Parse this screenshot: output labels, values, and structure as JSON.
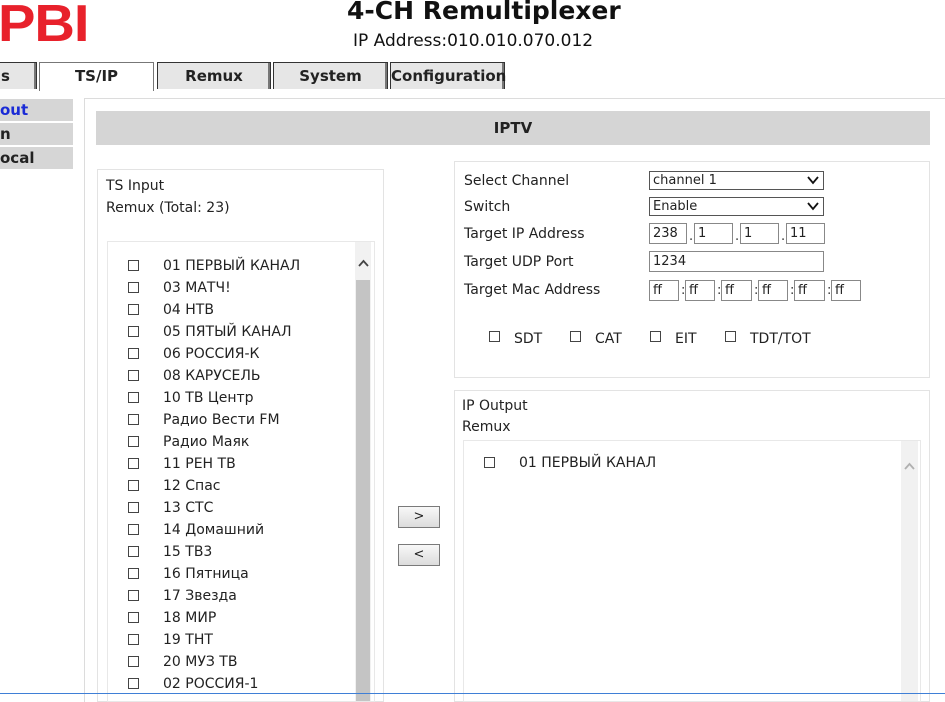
{
  "header": {
    "logo": "PBI",
    "title": "4-CH Remultiplexer",
    "ip_address": "IP Address:010.010.070.012"
  },
  "tabs": [
    {
      "label": "s"
    },
    {
      "label": "TS/IP"
    },
    {
      "label": "Remux"
    },
    {
      "label": "System"
    },
    {
      "label": "Configuration"
    }
  ],
  "sidebar": {
    "items": [
      {
        "label": "out"
      },
      {
        "label": "n"
      },
      {
        "label": "ocal"
      }
    ]
  },
  "section_title": "IPTV",
  "ts_input": {
    "title": "TS Input",
    "subtitle": "Remux (Total: 23)",
    "items": [
      {
        "label": "01 ПЕРВЫЙ КАНАЛ"
      },
      {
        "label": "03 МАТЧ!"
      },
      {
        "label": "04 НТВ"
      },
      {
        "label": "05 ПЯТЫЙ КАНАЛ"
      },
      {
        "label": "06 РОССИЯ-К"
      },
      {
        "label": "08 КАРУСЕЛЬ"
      },
      {
        "label": "10 ТВ Центр"
      },
      {
        "label": "Радио Вести FM"
      },
      {
        "label": "Радио Маяк"
      },
      {
        "label": "11 РЕН ТВ"
      },
      {
        "label": "12 Спас"
      },
      {
        "label": "13 СТС"
      },
      {
        "label": "14 Домашний"
      },
      {
        "label": "15 ТВ3"
      },
      {
        "label": "16 Пятница"
      },
      {
        "label": "17 Звезда"
      },
      {
        "label": "18 МИР"
      },
      {
        "label": "19 ТНТ"
      },
      {
        "label": "20 МУЗ ТВ"
      },
      {
        "label": "02 РОССИЯ-1"
      }
    ]
  },
  "settings": {
    "select_channel_label": "Select Channel",
    "select_channel_value": "channel 1",
    "switch_label": "Switch",
    "switch_value": "Enable",
    "target_ip_label": "Target IP Address",
    "target_ip": [
      "238",
      "1",
      "1",
      "11"
    ],
    "target_udp_label": "Target UDP Port",
    "target_udp_value": "1234",
    "target_mac_label": "Target Mac Address",
    "target_mac": [
      "ff",
      "ff",
      "ff",
      "ff",
      "ff",
      "ff"
    ],
    "ip_dot": ".",
    "mac_colon": ":",
    "checkboxes": [
      {
        "label": "SDT"
      },
      {
        "label": "CAT"
      },
      {
        "label": "EIT"
      },
      {
        "label": "TDT/TOT"
      }
    ]
  },
  "ip_output": {
    "title": "IP Output",
    "subtitle": "Remux",
    "items": [
      {
        "label": "01 ПЕРВЫЙ КАНАЛ"
      }
    ]
  },
  "buttons": {
    "add": ">",
    "remove": "<"
  },
  "icons": {
    "scroll_up": "chevron-up-icon",
    "dropdown": "chevron-down-icon"
  },
  "colors": {
    "logo": "#e8212b",
    "active_nav": "#1a2bd6",
    "section_bar": "#d5d5d5"
  }
}
